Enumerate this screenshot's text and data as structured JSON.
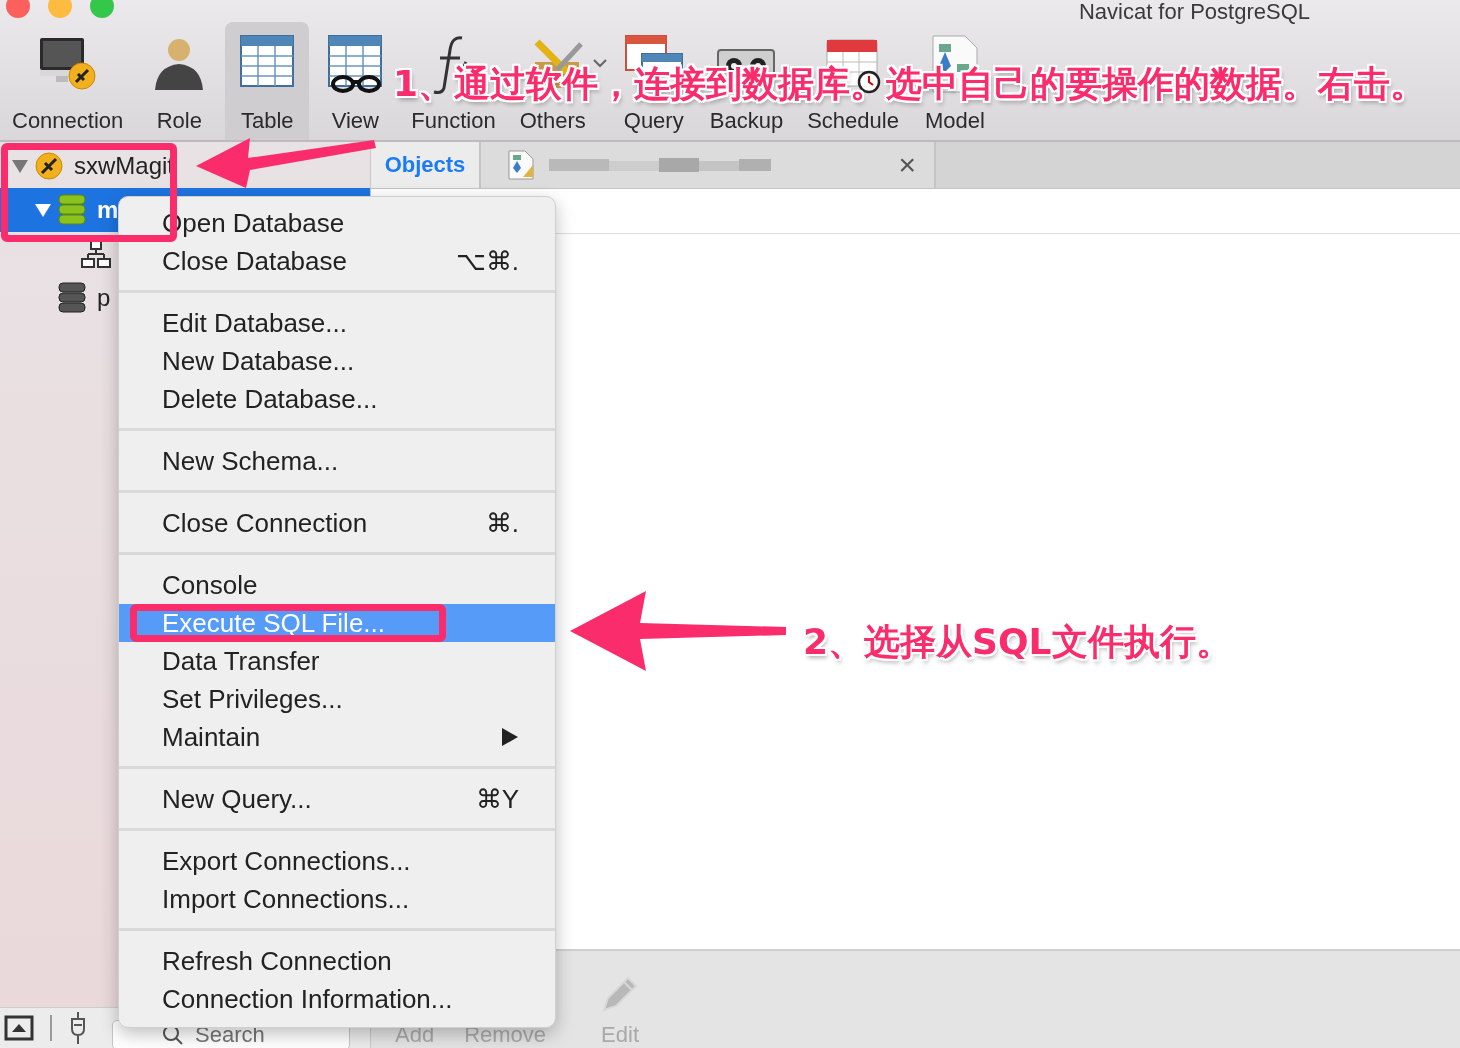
{
  "window": {
    "title": "Navicat for PostgreSQL"
  },
  "toolbar": {
    "items": [
      {
        "kind": "connection",
        "label": "Connection",
        "selected": false,
        "has_menu": false
      },
      {
        "kind": "role",
        "label": "Role",
        "selected": false,
        "has_menu": false
      },
      {
        "kind": "table",
        "label": "Table",
        "selected": true,
        "has_menu": false
      },
      {
        "kind": "view",
        "label": "View",
        "selected": false,
        "has_menu": false
      },
      {
        "kind": "function",
        "label": "Function",
        "selected": false,
        "has_menu": false
      },
      {
        "kind": "others",
        "label": "Others",
        "selected": false,
        "has_menu": true
      },
      {
        "kind": "query",
        "label": "Query",
        "selected": false,
        "has_menu": false
      },
      {
        "kind": "backup",
        "label": "Backup",
        "selected": false,
        "has_menu": false
      },
      {
        "kind": "schedule",
        "label": "Schedule",
        "selected": false,
        "has_menu": false
      },
      {
        "kind": "model",
        "label": "Model",
        "selected": false,
        "has_menu": false
      }
    ]
  },
  "sidebar": {
    "tree": [
      {
        "kind": "connection",
        "label": "sxwMagit",
        "expanded": true,
        "selected": false,
        "children": [
          {
            "kind": "database",
            "label": "m",
            "open": true,
            "expanded": true,
            "selected": true,
            "children": [
              {
                "kind": "schema",
                "selected": false
              }
            ]
          },
          {
            "kind": "database",
            "label": "p",
            "open": false,
            "selected": false
          }
        ]
      }
    ],
    "search": {
      "placeholder": "Search"
    }
  },
  "tabs": [
    {
      "kind": "objects",
      "label": "Objects",
      "selected": true
    },
    {
      "kind": "document",
      "selected": false,
      "close": "×"
    }
  ],
  "object_actions": [
    {
      "kind": "add",
      "label": "Add",
      "disabled": true
    },
    {
      "kind": "remove",
      "label": "Remove",
      "disabled": true
    },
    {
      "kind": "edit",
      "label": "Edit",
      "disabled": true
    }
  ],
  "context_menu": {
    "groups": [
      [
        {
          "label": "Open Database",
          "selected": false,
          "submenu": false
        },
        {
          "label": "Close Database",
          "shortcut": "⌥⌘.",
          "selected": false,
          "submenu": false
        }
      ],
      [
        {
          "label": "Edit Database...",
          "selected": false,
          "submenu": false
        },
        {
          "label": "New Database...",
          "selected": false,
          "submenu": false
        },
        {
          "label": "Delete Database...",
          "selected": false,
          "submenu": false
        }
      ],
      [
        {
          "label": "New Schema...",
          "selected": false,
          "submenu": false
        }
      ],
      [
        {
          "label": "Close Connection",
          "shortcut": "⌘.",
          "selected": false,
          "submenu": false
        }
      ],
      [
        {
          "label": "Console",
          "selected": false,
          "submenu": false
        },
        {
          "label": "Execute SQL File...",
          "selected": true,
          "submenu": false
        },
        {
          "label": "Data Transfer",
          "selected": false,
          "submenu": false
        },
        {
          "label": "Set Privileges...",
          "selected": false,
          "submenu": false
        },
        {
          "label": "Maintain",
          "selected": false,
          "submenu": true
        }
      ],
      [
        {
          "label": "New Query...",
          "shortcut": "⌘Y",
          "selected": false,
          "submenu": false
        }
      ],
      [
        {
          "label": "Export Connections...",
          "selected": false,
          "submenu": false
        },
        {
          "label": "Import Connections...",
          "selected": false,
          "submenu": false
        }
      ],
      [
        {
          "label": "Refresh Connection",
          "selected": false,
          "submenu": false
        },
        {
          "label": "Connection Information...",
          "selected": false,
          "submenu": false
        }
      ]
    ]
  },
  "annotations": [
    {
      "text": "1、通过软件，连接到数据库。选中自己的要操作的数据。右击。"
    },
    {
      "text": "2、选择从SQL文件执行。"
    }
  ]
}
